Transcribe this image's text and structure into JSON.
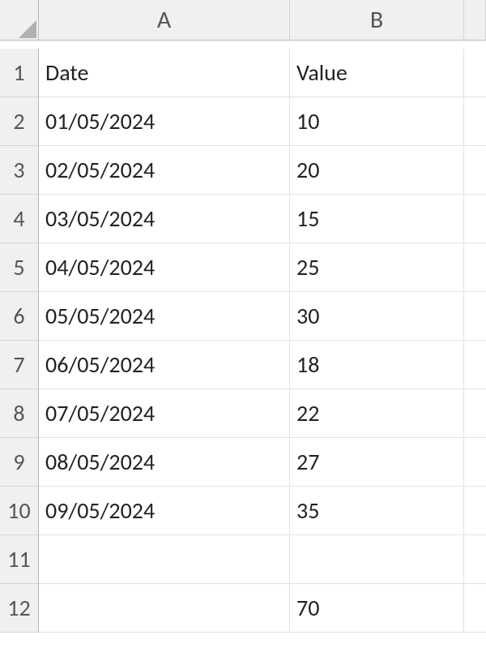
{
  "columnHeaders": [
    "A",
    "B"
  ],
  "rowHeaders": [
    "1",
    "2",
    "3",
    "4",
    "5",
    "6",
    "7",
    "8",
    "9",
    "10",
    "11",
    "12"
  ],
  "cells": {
    "A1": "Date",
    "B1": "Value",
    "A2": "01/05/2024",
    "B2": "10",
    "A3": "02/05/2024",
    "B3": "20",
    "A4": "03/05/2024",
    "B4": "15",
    "A5": "04/05/2024",
    "B5": "25",
    "A6": "05/05/2024",
    "B6": "30",
    "A7": "06/05/2024",
    "B7": "18",
    "A8": "07/05/2024",
    "B8": "22",
    "A9": "08/05/2024",
    "B9": "27",
    "A10": "09/05/2024",
    "B10": "35",
    "A11": "",
    "B11": "",
    "A12": "",
    "B12": "70"
  }
}
